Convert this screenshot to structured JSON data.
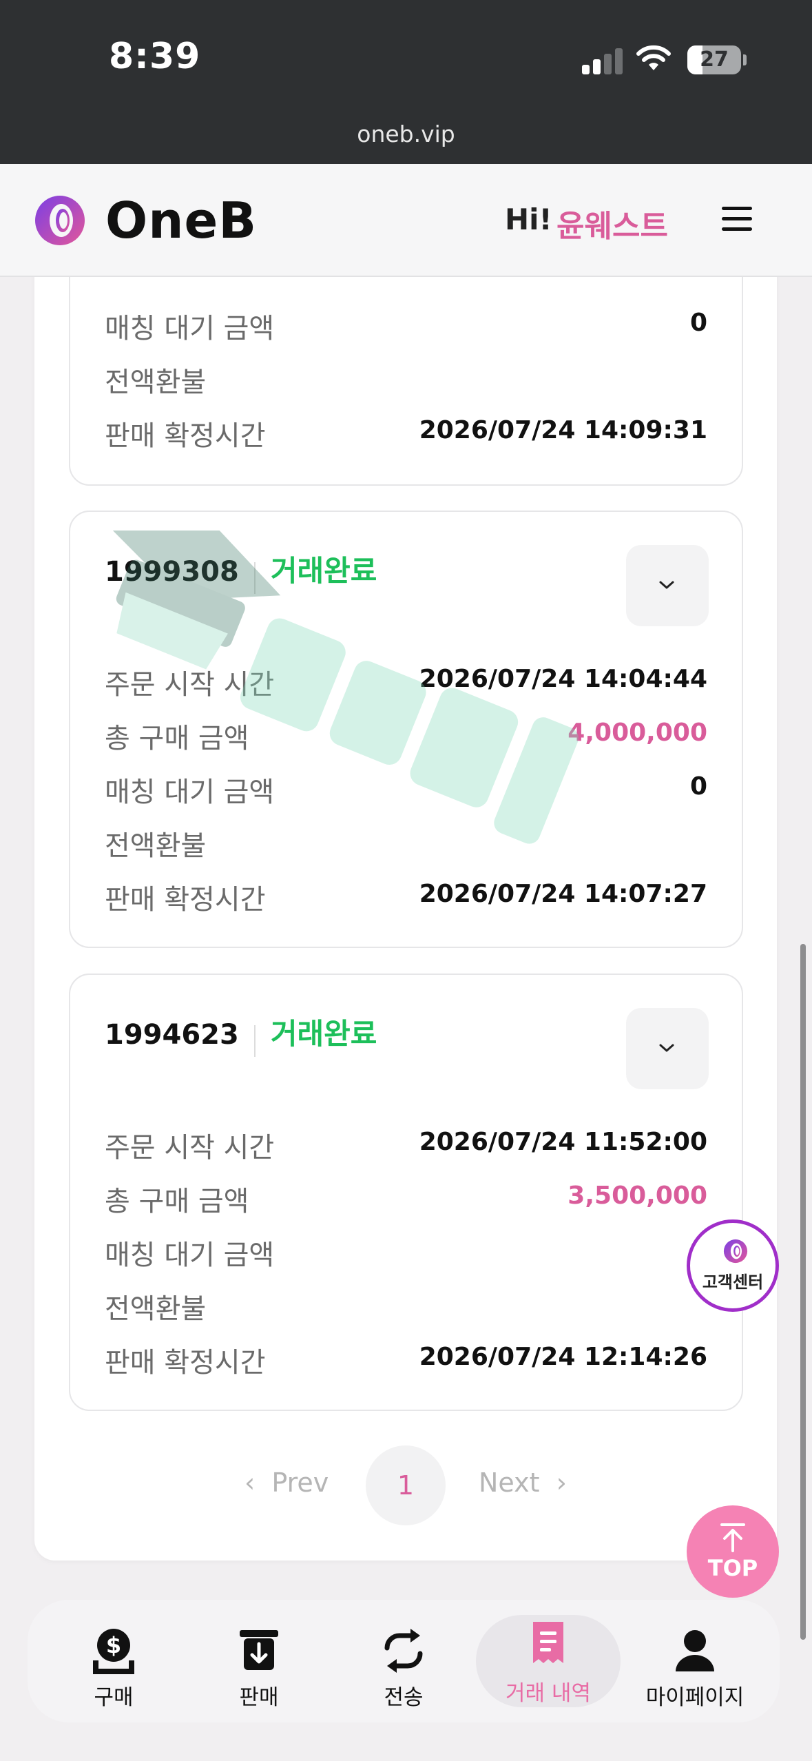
{
  "status_bar": {
    "time": "8:39",
    "battery": "27",
    "url": "oneb.vip"
  },
  "header": {
    "brand": "OneB",
    "greeting": "Hi!",
    "username": "윤웨스트"
  },
  "labels": {
    "start_time": "주문 시작 시간",
    "total_amount": "총 구매 금액",
    "matching_wait": "매칭 대기 금액",
    "refund": "전액환불",
    "confirm_time": "판매 확정시간"
  },
  "cards": [
    {
      "matching_wait": "0",
      "confirm_time": "2026/07/24 14:09:31"
    },
    {
      "order_id": "1999308",
      "status": "거래완료",
      "start_time": "2026/07/24 14:04:44",
      "total_amount": "4,000,000",
      "matching_wait": "0",
      "confirm_time": "2026/07/24 14:07:27"
    },
    {
      "order_id": "1994623",
      "status": "거래완료",
      "start_time": "2026/07/24 11:52:00",
      "total_amount": "3,500,000",
      "confirm_time": "2026/07/24 12:14:26"
    }
  ],
  "pagination": {
    "prev": "Prev",
    "page": "1",
    "next": "Next"
  },
  "floating": {
    "customer_center": "고객센터",
    "top": "TOP"
  },
  "bottom_nav": [
    {
      "label": "구매",
      "icon": "dollar-tray-icon"
    },
    {
      "label": "판매",
      "icon": "sell-box-icon"
    },
    {
      "label": "전송",
      "icon": "transfer-arrows-icon"
    },
    {
      "label": "거래 내역",
      "icon": "receipt-icon",
      "active": true
    },
    {
      "label": "마이페이지",
      "icon": "user-icon"
    }
  ],
  "colors": {
    "accent_pink": "#d95c9a",
    "status_green": "#1dbf5a",
    "nav_active": "#e86ca5",
    "top_button": "#f582b4"
  }
}
